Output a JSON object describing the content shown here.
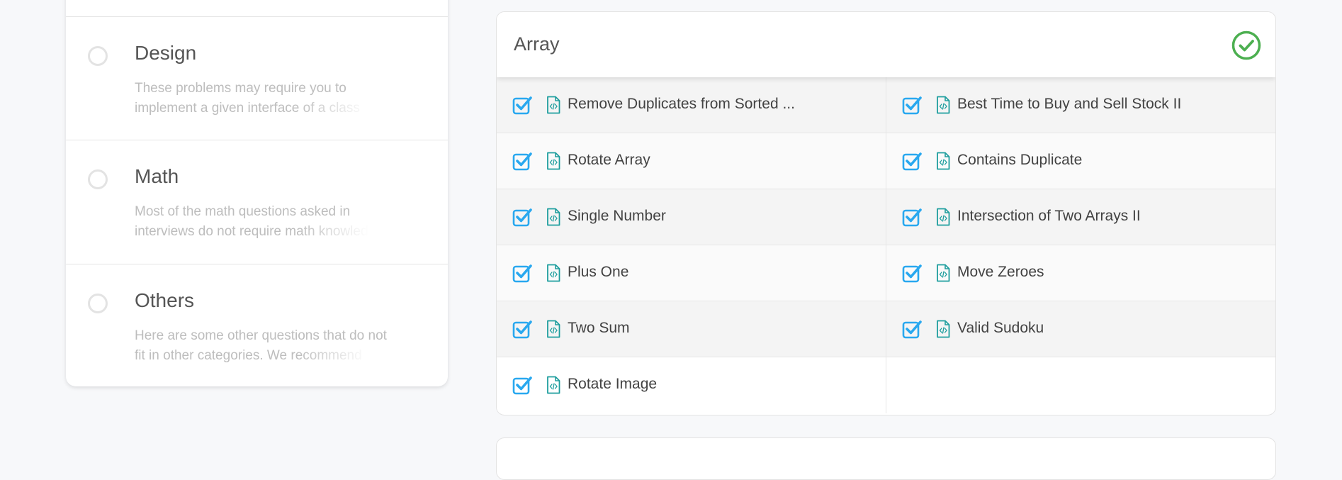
{
  "categories": [
    {
      "title": "Design",
      "desc_line1": "These problems may require you to",
      "desc_line2": "implement a given interface of a class"
    },
    {
      "title": "Math",
      "desc_line1": "Most of the math questions asked in",
      "desc_line2": "interviews do not require math knowledge"
    },
    {
      "title": "Others",
      "desc_line1": "Here are some other questions that do not",
      "desc_line2": "fit in other categories. We recommend"
    }
  ],
  "array_section": {
    "title": "Array",
    "status": "completed",
    "completed_color": "#4caf50",
    "check_color": "#29a8ef",
    "file_icon_color": "#1e9e9e",
    "questions": [
      "Remove Duplicates from Sorted ...",
      "Best Time to Buy and Sell Stock II",
      "Rotate Array",
      "Contains Duplicate",
      "Single Number",
      "Intersection of Two Arrays II",
      "Plus One",
      "Move Zeroes",
      "Two Sum",
      "Valid Sudoku",
      "Rotate Image"
    ]
  }
}
